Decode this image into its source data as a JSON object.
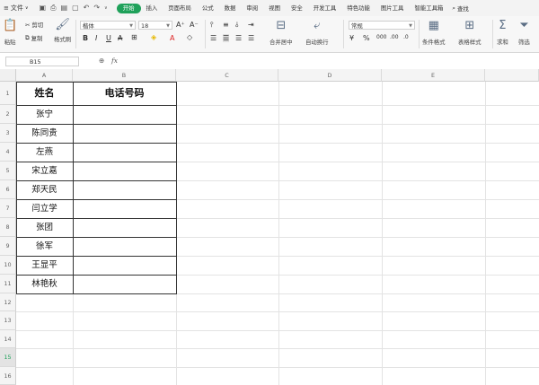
{
  "menu": {
    "file_label": "文件",
    "tabs": [
      "开始",
      "插入",
      "页面布局",
      "公式",
      "数据",
      "审阅",
      "视图",
      "安全",
      "开发工具",
      "特色功能",
      "图片工具",
      "智能工具箱"
    ],
    "active_tab": "开始",
    "search_label": "查找"
  },
  "ribbon": {
    "paste_label": "粘贴",
    "cut_label": "剪切",
    "copy_label": "复制",
    "format_painter_label": "格式刷",
    "font_name": "楷体",
    "font_size": "18",
    "merge_label": "合并居中",
    "wrap_label": "自动换行",
    "number_format": "常规",
    "conditional_label": "条件格式",
    "table_style_label": "表格样式",
    "sum_label": "求和",
    "filter_label": "筛选",
    "accent": "#1fa15a"
  },
  "formula_bar": {
    "name_box": "B15",
    "fx_label": "fx"
  },
  "sheet": {
    "columns": [
      "A",
      "B",
      "C",
      "D",
      "E"
    ],
    "rows": [
      "1",
      "2",
      "3",
      "4",
      "5",
      "6",
      "7",
      "8",
      "9",
      "10",
      "11",
      "12",
      "13",
      "14",
      "15",
      "16"
    ],
    "header_a": "姓名",
    "header_b": "电话号码",
    "names": [
      "张宁",
      "陈同贵",
      "左燕",
      "宋立嘉",
      "郑天民",
      "闫立学",
      "张团",
      "徐军",
      "王显平",
      "林艳秋"
    ]
  }
}
